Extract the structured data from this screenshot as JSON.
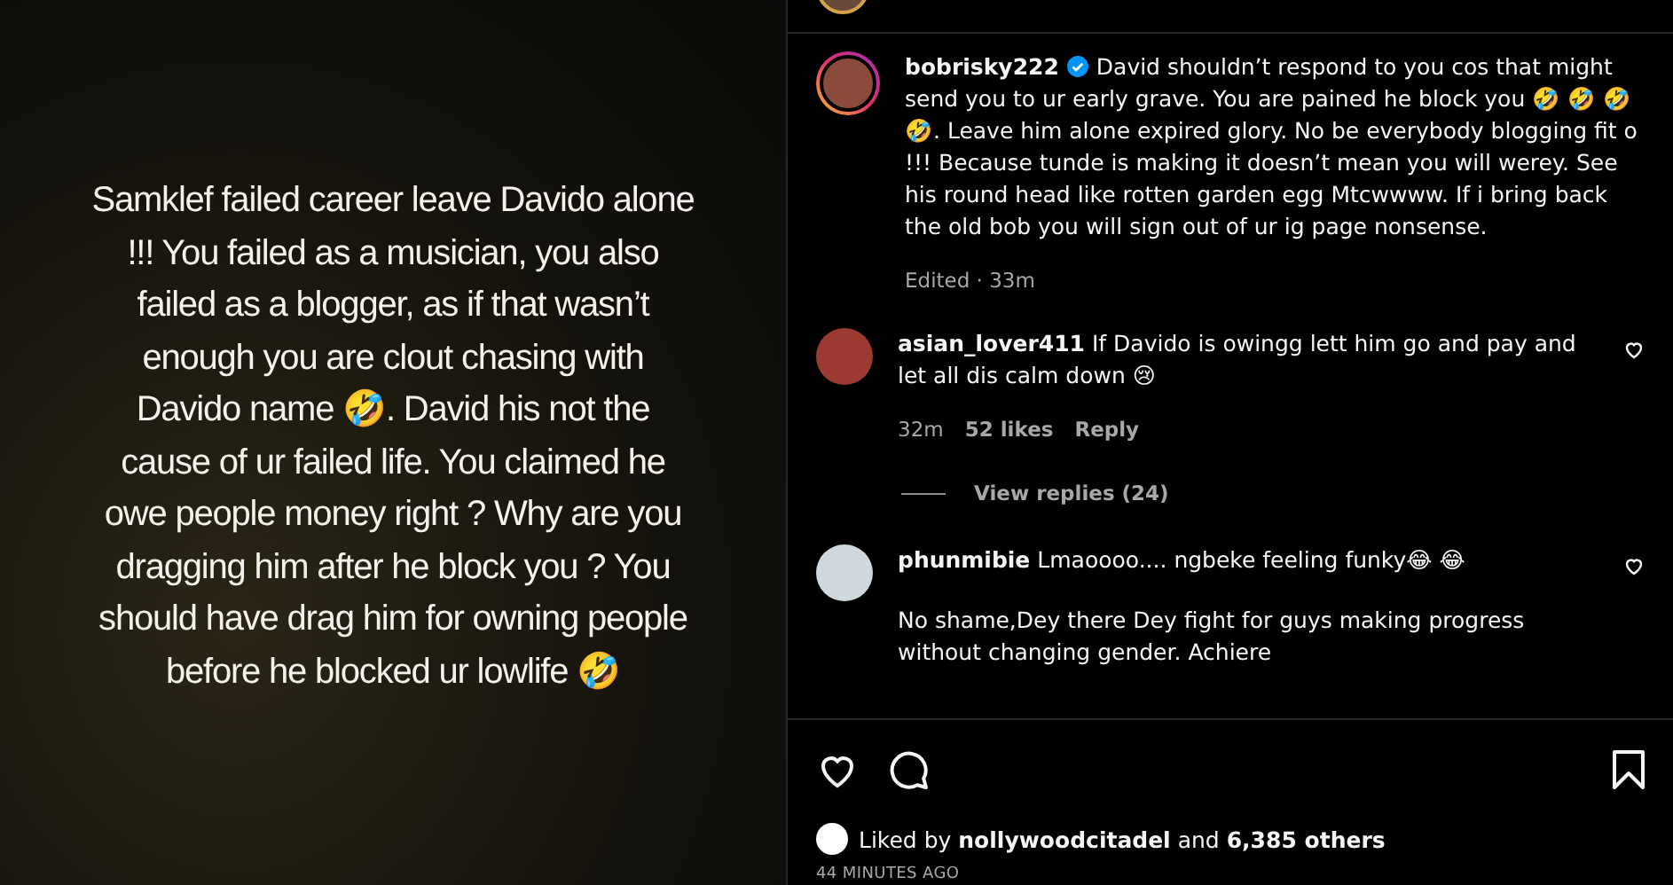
{
  "story_text": "Samklef failed career leave Davido alone !!! You failed as a musician, you also failed as a blogger, as if that wasn’t enough you are clout chasing with Davido name 🤣. David his not the cause of ur failed life. You claimed he owe people money right ? Why are you dragging him after he block you ? You should have drag him for owning people before he blocked ur lowlife 🤣",
  "caption": {
    "username": "bobrisky222",
    "verified": true,
    "story_ring": true,
    "text": "David shouldn’t respond to you cos that might send you to ur early grave. You are pained he block you 🤣 🤣 🤣 🤣. Leave him alone expired glory. No be everybody blogging fit o !!! Because tunde is making it doesn’t mean you will werey. See his round head like rotten garden egg Mtcwwww. If i bring back the old bob you will sign out of ur ig page nonsense.",
    "meta": "Edited · 33m"
  },
  "comments": [
    {
      "username": "asian_lover411",
      "text": "If Davido is owingg lett him go and pay and let all dis calm down 😢",
      "time": "32m",
      "likes": "52 likes",
      "reply": "Reply",
      "view_replies": "View replies (24)",
      "liked": false
    },
    {
      "username": "phunmibie",
      "text": "Lmaoooo.... ngbeke feeling funky😂 😂",
      "extra": "No shame,Dey there Dey fight for guys making progress without changing gender. Achiere",
      "liked": false
    }
  ],
  "likes": {
    "prefix": "Liked by",
    "user": "nollywoodcitadel",
    "suffix": "and",
    "count": "6,385 others"
  },
  "timestamp": "44 MINUTES AGO"
}
